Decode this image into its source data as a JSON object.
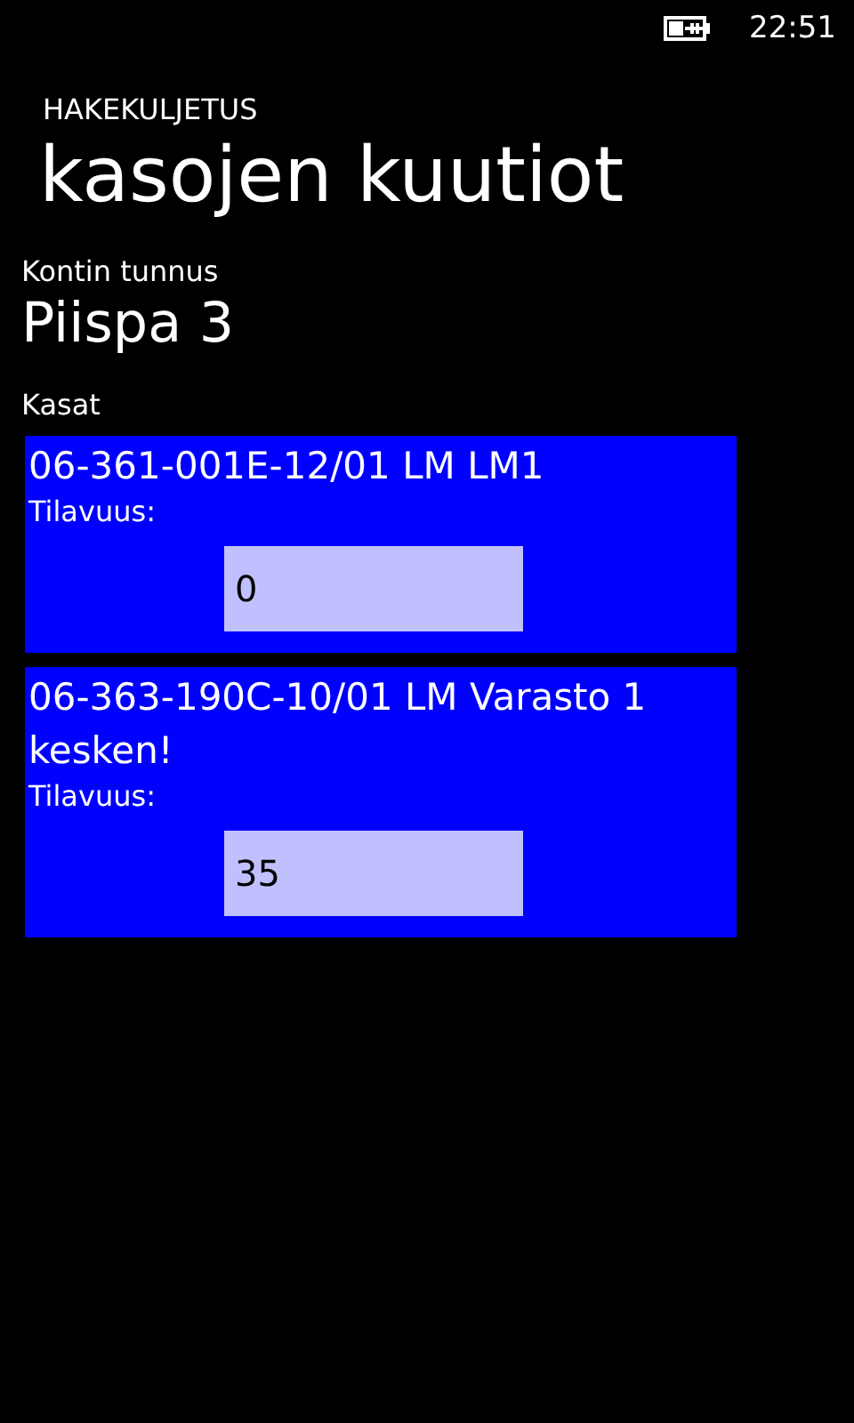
{
  "status_bar": {
    "time": "22:51"
  },
  "app_title": "HAKEKULJETUS",
  "page_title": "kasojen kuutiot",
  "container": {
    "label": "Kontin tunnus",
    "value": "Piispa 3"
  },
  "piles_label": "Kasat",
  "piles": [
    {
      "title": "06-361-001E-12/01 LM LM1",
      "volume_label": "Tilavuus:",
      "volume": "0"
    },
    {
      "title": "06-363-190C-10/01 LM Varasto 1 kesken!",
      "volume_label": "Tilavuus:",
      "volume": "35"
    }
  ]
}
